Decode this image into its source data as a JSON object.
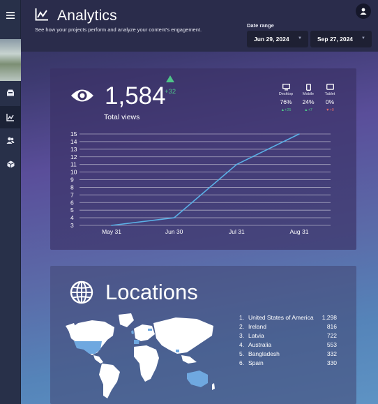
{
  "header": {
    "title": "Analytics",
    "subtitle": "See how your projects perform and analyze your content's engagement.",
    "date_range_label": "Date range",
    "start_date": "Jun 29, 2024",
    "end_date": "Sep 27, 2024"
  },
  "sidebar": {
    "items": [
      {
        "icon": "menu-icon"
      },
      {
        "icon": "avatar"
      },
      {
        "icon": "inbox-icon"
      },
      {
        "icon": "analytics-icon",
        "active": true
      },
      {
        "icon": "users-icon"
      },
      {
        "icon": "box-icon"
      }
    ]
  },
  "views": {
    "count": "1,584",
    "delta": "+32",
    "label": "Total views",
    "devices": [
      {
        "name": "Desktop",
        "percent": "76%",
        "delta": "+25",
        "direction": "up",
        "icon": "desktop-icon"
      },
      {
        "name": "Mobile",
        "percent": "24%",
        "delta": "+7",
        "direction": "up",
        "icon": "mobile-icon"
      },
      {
        "name": "Tablet",
        "percent": "0%",
        "delta": "+0",
        "direction": "down",
        "icon": "tablet-icon"
      }
    ]
  },
  "chart_data": {
    "type": "line",
    "title": "",
    "xlabel": "",
    "ylabel": "",
    "x": [
      "May 31",
      "Jun 30",
      "Jul 31",
      "Aug 31"
    ],
    "y_ticks": [
      3,
      4,
      5,
      6,
      7,
      8,
      9,
      10,
      11,
      12,
      13,
      14,
      15
    ],
    "ylim": [
      3,
      15
    ],
    "grid": true,
    "series": [
      {
        "points": [
          {
            "x": "May 31",
            "y": 3
          },
          {
            "x": "Jun 30",
            "y": 4
          },
          {
            "x": "Jul 31",
            "y": 11
          },
          {
            "x": "Aug 31",
            "y": 15
          }
        ],
        "color": "#5ab0e6"
      }
    ]
  },
  "locations": {
    "title": "Locations",
    "rows": [
      {
        "rank": "1.",
        "name": "United States of America",
        "count": "1,298"
      },
      {
        "rank": "2.",
        "name": "Ireland",
        "count": "816"
      },
      {
        "rank": "3.",
        "name": "Latvia",
        "count": "722"
      },
      {
        "rank": "4.",
        "name": "Australia",
        "count": "553"
      },
      {
        "rank": "5.",
        "name": "Bangladesh",
        "count": "332"
      },
      {
        "rank": "6.",
        "name": "Spain",
        "count": "330"
      }
    ]
  },
  "colors": {
    "accent_line": "#5ab0e6",
    "positive": "#4fc489",
    "negative": "#e06b6b",
    "map_highlight": "#6fa8e0"
  }
}
